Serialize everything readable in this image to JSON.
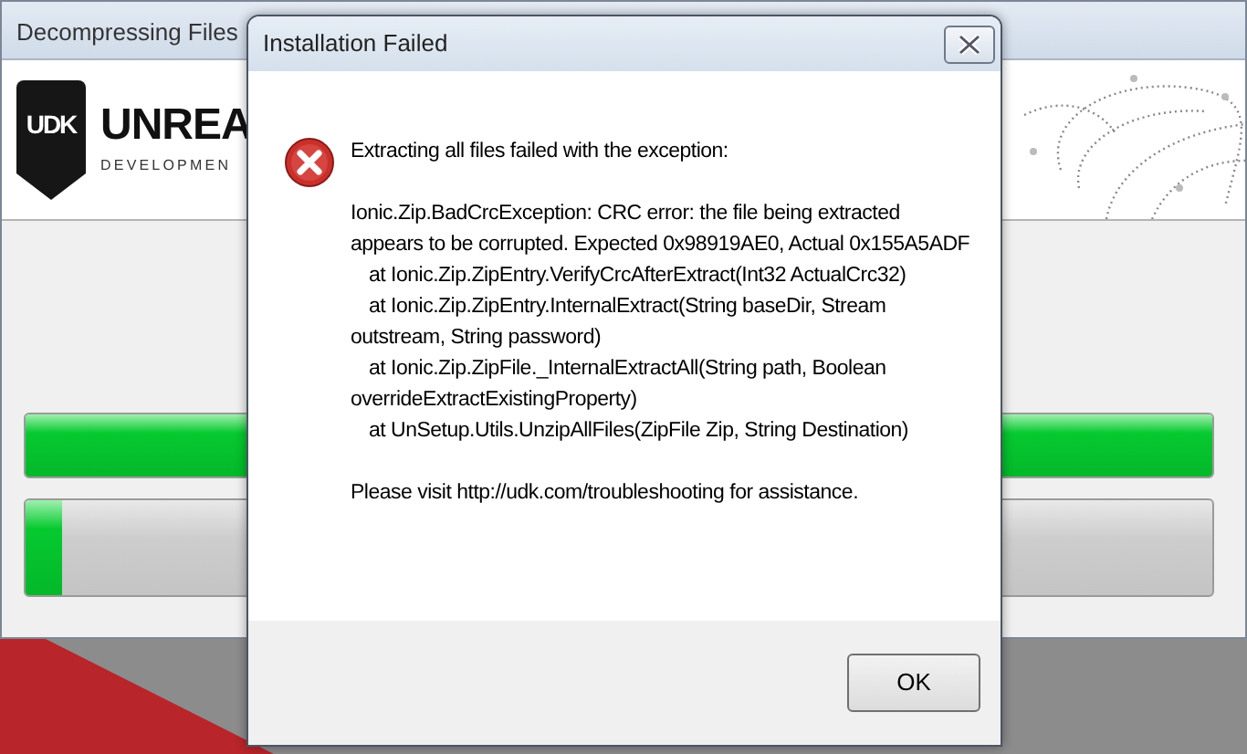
{
  "background_window": {
    "title": "Decompressing Files",
    "logo": {
      "badge": "UDK",
      "wordmark": "UNREA",
      "tagline": "DEVELOPMEN"
    },
    "progress_bars": [
      {
        "level": 1
      },
      {
        "level": 0.03
      }
    ]
  },
  "dialog": {
    "title": "Installation Failed",
    "heading": "Extracting all files failed with the exception:",
    "exception": "Ionic.Zip.BadCrcException: CRC error: the file being extracted appears to be corrupted. Expected 0x98919AE0, Actual 0x155A5ADF",
    "stack_trace": [
      "at Ionic.Zip.ZipEntry.VerifyCrcAfterExtract(Int32 ActualCrc32)",
      "at Ionic.Zip.ZipEntry.InternalExtract(String baseDir, Stream outstream, String password)",
      "at Ionic.Zip.ZipFile._InternalExtractAll(String path, Boolean overrideExtractExistingProperty)",
      "at UnSetup.Utils.UnzipAllFiles(ZipFile Zip, String Destination)"
    ],
    "footer_note": "Please visit http://udk.com/troubleshooting for assistance.",
    "buttons": [
      "OK"
    ]
  }
}
